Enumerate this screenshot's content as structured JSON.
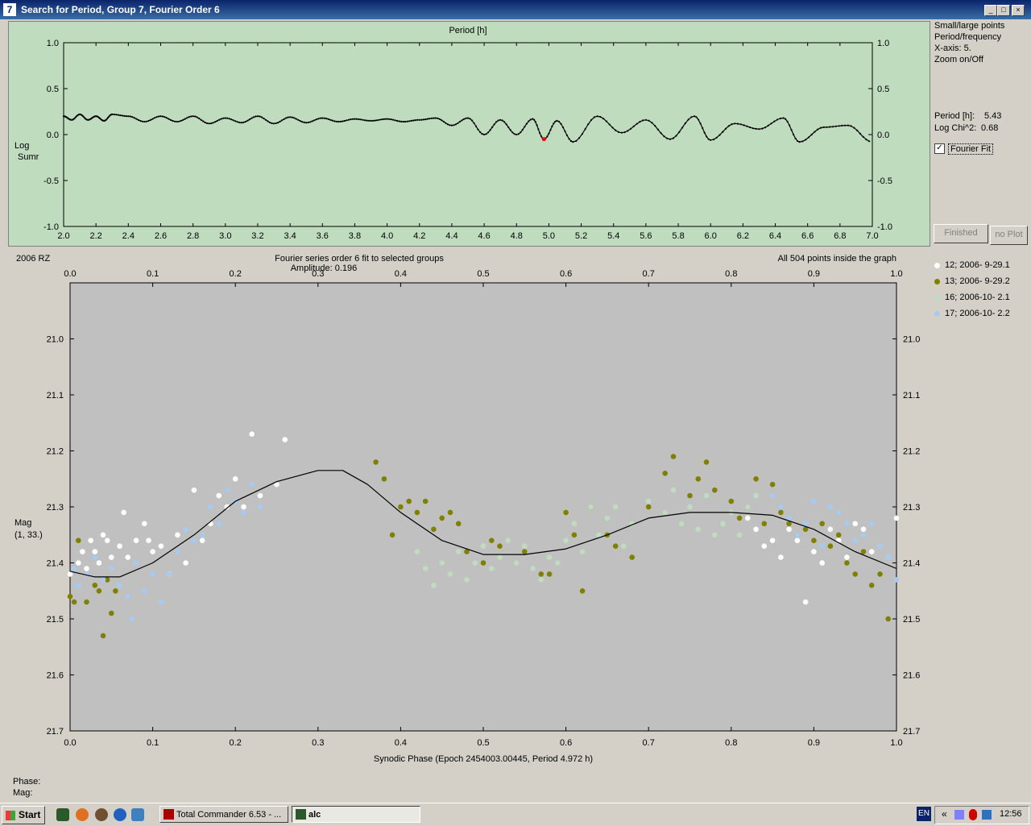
{
  "window": {
    "title": "Search for Period, Group 7, Fourier Order 6",
    "app_icon": "7"
  },
  "top_panel": {
    "header": "Period [h]",
    "ylabel_line1": "Log",
    "ylabel_line2": "Sumr",
    "side_options": [
      "Small/large points",
      "Period/frequency",
      "X-axis: 5.",
      "Zoom on/Off"
    ],
    "period_label": "Period [h]:",
    "period_value": "5.43",
    "chi_label": "Log Chi^2:",
    "chi_value": "0.68",
    "fourier_fit_label": "Fourier Fit",
    "fourier_fit_checked": true,
    "finished_label": "Finished",
    "noplot_label": "no Plot"
  },
  "bottom_panel": {
    "object": "2006 RZ",
    "title": "Fourier series order 6 fit to selected groups",
    "amplitude": "Amplitude: 0.196",
    "points_info": "All 504 points inside the graph",
    "ylabel_line1": "Mag",
    "ylabel_line2": "(1, 33.)",
    "xlabel": "Synodic Phase (Epoch 2454003.00445, Period 4.972 h)"
  },
  "legend": [
    {
      "label": "12; 2006- 9-29.1",
      "color": "#ffffff"
    },
    {
      "label": "13; 2006- 9-29.2",
      "color": "#808000"
    },
    {
      "label": "16; 2006-10- 2.1",
      "color": "#c0dcc0"
    },
    {
      "label": "17; 2006-10- 2.2",
      "color": "#a6caf0"
    }
  ],
  "status": {
    "phase_label": "Phase:",
    "mag_label": "Mag:"
  },
  "taskbar": {
    "start_label": "Start",
    "tasks": [
      {
        "label": "Total Commander 6.53 - ..."
      },
      {
        "label": "alc"
      }
    ],
    "lang": "EN",
    "time": "12:56"
  },
  "chart_data": [
    {
      "type": "line",
      "title": "Period [h]",
      "xlabel": "",
      "ylabel": "Log Sumr",
      "xlim": [
        2.0,
        7.0
      ],
      "ylim": [
        -1.0,
        1.0
      ],
      "x_ticks": [
        "2.0",
        "2.2",
        "2.4",
        "2.6",
        "2.8",
        "3.0",
        "3.2",
        "3.4",
        "3.6",
        "3.8",
        "4.0",
        "4.2",
        "4.4",
        "4.6",
        "4.8",
        "5.0",
        "5.2",
        "5.4",
        "5.6",
        "5.8",
        "6.0",
        "6.2",
        "6.4",
        "6.6",
        "6.8",
        "7.0"
      ],
      "y_ticks": [
        "1.0",
        "0.5",
        "0.0",
        "-0.5",
        "-1.0"
      ],
      "grid": false,
      "line_color": "#000000",
      "x": [
        2.0,
        2.05,
        2.1,
        2.15,
        2.2,
        2.25,
        2.3,
        2.4,
        2.5,
        2.6,
        2.7,
        2.8,
        2.9,
        3.0,
        3.1,
        3.2,
        3.3,
        3.4,
        3.5,
        3.6,
        3.7,
        3.8,
        3.9,
        4.0,
        4.1,
        4.2,
        4.3,
        4.4,
        4.5,
        4.6,
        4.7,
        4.8,
        4.9,
        4.97,
        5.05,
        5.15,
        5.3,
        5.45,
        5.6,
        5.75,
        5.9,
        6.0,
        6.15,
        6.3,
        6.45,
        6.55,
        6.7,
        6.85,
        7.0
      ],
      "y": [
        0.2,
        0.16,
        0.22,
        0.16,
        0.2,
        0.15,
        0.22,
        0.2,
        0.14,
        0.2,
        0.14,
        0.2,
        0.12,
        0.18,
        0.13,
        0.2,
        0.12,
        0.19,
        0.13,
        0.18,
        0.14,
        0.17,
        0.15,
        0.17,
        0.14,
        0.16,
        0.18,
        0.1,
        0.18,
        0.0,
        0.16,
        0.0,
        0.17,
        -0.05,
        0.15,
        -0.08,
        0.2,
        0.02,
        0.16,
        -0.05,
        0.2,
        -0.06,
        0.12,
        0.06,
        0.18,
        -0.08,
        0.08,
        0.1,
        -0.08
      ],
      "highlight": {
        "x": 4.97,
        "y": -0.05,
        "color": "#ff0000"
      }
    },
    {
      "type": "scatter",
      "title": "Fourier series order 6 fit to selected groups",
      "xlabel": "Synodic Phase (Epoch 2454003.00445, Period 4.972 h)",
      "ylabel": "Mag (1, 33.)",
      "xlim": [
        0.0,
        1.0
      ],
      "ylim": [
        21.7,
        20.9
      ],
      "y_inverted": true,
      "x_ticks": [
        "0.0",
        "0.1",
        "0.2",
        "0.3",
        "0.4",
        "0.5",
        "0.6",
        "0.7",
        "0.8",
        "0.9",
        "1.0"
      ],
      "y_ticks": [
        "21.0",
        "21.1",
        "21.2",
        "21.3",
        "21.4",
        "21.5",
        "21.6",
        "21.7"
      ],
      "grid": false,
      "fit": {
        "name": "",
        "x": [
          0.0,
          0.03,
          0.06,
          0.1,
          0.15,
          0.2,
          0.25,
          0.3,
          0.33,
          0.36,
          0.4,
          0.45,
          0.5,
          0.55,
          0.6,
          0.65,
          0.7,
          0.75,
          0.8,
          0.85,
          0.9,
          0.95,
          1.0
        ],
        "y": [
          21.415,
          21.425,
          21.425,
          21.4,
          21.35,
          21.29,
          21.255,
          21.235,
          21.235,
          21.26,
          21.31,
          21.36,
          21.385,
          21.385,
          21.375,
          21.35,
          21.32,
          21.31,
          21.31,
          21.315,
          21.34,
          21.38,
          21.41
        ]
      },
      "series": [
        {
          "name": "12; 2006- 9-29.1",
          "color": "#ffffff",
          "x": [
            0.0,
            0.01,
            0.015,
            0.02,
            0.025,
            0.03,
            0.035,
            0.04,
            0.045,
            0.05,
            0.06,
            0.065,
            0.07,
            0.08,
            0.09,
            0.095,
            0.1,
            0.11,
            0.12,
            0.13,
            0.14,
            0.15,
            0.16,
            0.17,
            0.18,
            0.19,
            0.2,
            0.21,
            0.22,
            0.23,
            0.25,
            0.26,
            0.82,
            0.83,
            0.84,
            0.85,
            0.86,
            0.87,
            0.88,
            0.89,
            0.9,
            0.91,
            0.92,
            0.93,
            0.94,
            0.95,
            0.96,
            0.97,
            0.98,
            0.99,
            1.0
          ],
          "y": [
            21.42,
            21.4,
            21.38,
            21.41,
            21.36,
            21.38,
            21.4,
            21.35,
            21.36,
            21.39,
            21.37,
            21.31,
            21.39,
            21.36,
            21.33,
            21.36,
            21.38,
            21.37,
            21.42,
            21.35,
            21.4,
            21.27,
            21.36,
            21.33,
            21.28,
            21.3,
            21.25,
            21.3,
            21.17,
            21.28,
            21.26,
            21.18,
            21.32,
            21.34,
            21.37,
            21.36,
            21.39,
            21.34,
            21.36,
            21.47,
            21.38,
            21.4,
            21.34,
            21.36,
            21.39,
            21.33,
            21.34,
            21.38,
            21.37,
            21.39,
            21.32
          ]
        },
        {
          "name": "13; 2006- 9-29.2",
          "color": "#808000",
          "x": [
            0.0,
            0.005,
            0.01,
            0.02,
            0.03,
            0.035,
            0.04,
            0.045,
            0.05,
            0.055,
            0.37,
            0.38,
            0.39,
            0.4,
            0.41,
            0.42,
            0.43,
            0.44,
            0.45,
            0.46,
            0.47,
            0.48,
            0.5,
            0.51,
            0.52,
            0.55,
            0.57,
            0.58,
            0.6,
            0.61,
            0.62,
            0.63,
            0.65,
            0.66,
            0.68,
            0.7,
            0.72,
            0.73,
            0.75,
            0.76,
            0.77,
            0.78,
            0.8,
            0.81,
            0.82,
            0.83,
            0.84,
            0.85,
            0.86,
            0.87,
            0.88,
            0.89,
            0.9,
            0.91,
            0.92,
            0.93,
            0.94,
            0.95,
            0.96,
            0.97,
            0.98,
            0.99
          ],
          "y": [
            21.46,
            21.47,
            21.36,
            21.47,
            21.44,
            21.45,
            21.53,
            21.43,
            21.49,
            21.45,
            21.22,
            21.25,
            21.35,
            21.3,
            21.29,
            21.31,
            21.29,
            21.34,
            21.32,
            21.31,
            21.33,
            21.38,
            21.4,
            21.36,
            21.37,
            21.38,
            21.42,
            21.42,
            21.31,
            21.35,
            21.45,
            21.3,
            21.35,
            21.37,
            21.39,
            21.3,
            21.24,
            21.21,
            21.28,
            21.25,
            21.22,
            21.27,
            21.29,
            21.32,
            21.3,
            21.25,
            21.33,
            21.26,
            21.31,
            21.33,
            21.35,
            21.34,
            21.36,
            21.33,
            21.37,
            21.35,
            21.4,
            21.42,
            21.38,
            21.44,
            21.42,
            21.5
          ]
        },
        {
          "name": "16; 2006-10- 2.1",
          "color": "#c0dcc0",
          "x": [
            0.42,
            0.43,
            0.44,
            0.45,
            0.46,
            0.47,
            0.48,
            0.49,
            0.5,
            0.51,
            0.52,
            0.53,
            0.54,
            0.55,
            0.56,
            0.57,
            0.58,
            0.59,
            0.6,
            0.61,
            0.62,
            0.63,
            0.64,
            0.65,
            0.66,
            0.67,
            0.68,
            0.7,
            0.72,
            0.73,
            0.74,
            0.75,
            0.76,
            0.77,
            0.78,
            0.79,
            0.8,
            0.81,
            0.82,
            0.83
          ],
          "y": [
            21.38,
            21.41,
            21.44,
            21.4,
            21.42,
            21.38,
            21.43,
            21.4,
            21.37,
            21.41,
            21.39,
            21.36,
            21.4,
            21.37,
            21.41,
            21.43,
            21.39,
            21.4,
            21.36,
            21.33,
            21.38,
            21.3,
            21.35,
            21.32,
            21.3,
            21.37,
            21.33,
            21.29,
            21.31,
            21.27,
            21.33,
            21.3,
            21.34,
            21.28,
            21.35,
            21.33,
            21.31,
            21.35,
            21.3,
            21.28
          ]
        },
        {
          "name": "17; 2006-10- 2.2",
          "color": "#a6caf0",
          "x": [
            0.005,
            0.01,
            0.02,
            0.03,
            0.04,
            0.05,
            0.06,
            0.07,
            0.075,
            0.08,
            0.09,
            0.1,
            0.11,
            0.12,
            0.13,
            0.14,
            0.15,
            0.16,
            0.17,
            0.18,
            0.19,
            0.2,
            0.21,
            0.22,
            0.23,
            0.85,
            0.86,
            0.87,
            0.88,
            0.89,
            0.9,
            0.91,
            0.92,
            0.93,
            0.94,
            0.95,
            0.96,
            0.97,
            0.98,
            0.99,
            1.0
          ],
          "y": [
            21.41,
            21.44,
            21.42,
            21.39,
            21.43,
            21.41,
            21.44,
            21.46,
            21.5,
            21.4,
            21.45,
            21.42,
            21.47,
            21.42,
            21.38,
            21.34,
            21.36,
            21.35,
            21.3,
            21.33,
            21.27,
            21.29,
            21.31,
            21.26,
            21.3,
            21.28,
            21.3,
            21.32,
            21.35,
            21.33,
            21.29,
            21.37,
            21.3,
            21.31,
            21.33,
            21.36,
            21.35,
            21.33,
            21.37,
            21.39,
            21.43
          ]
        }
      ]
    }
  ]
}
